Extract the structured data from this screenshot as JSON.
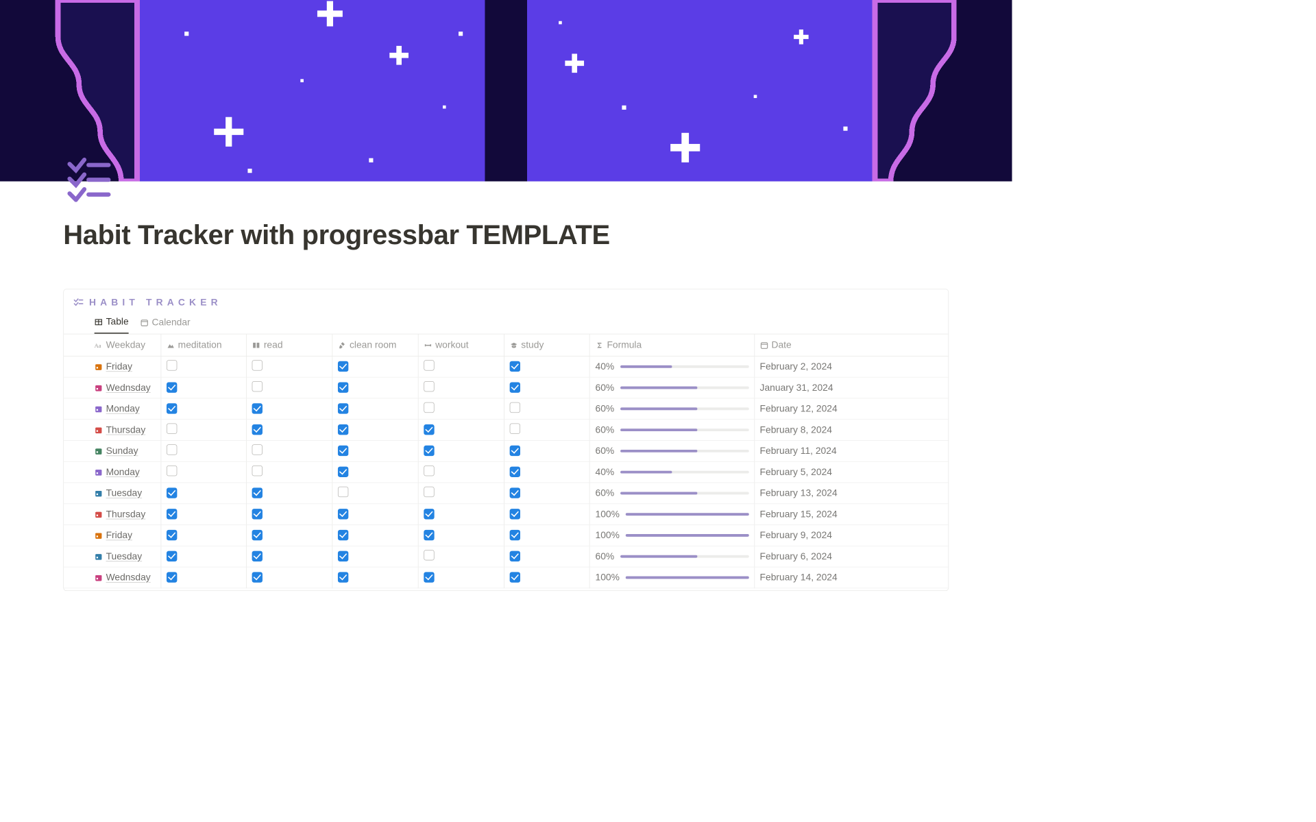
{
  "page": {
    "title": "Habit Tracker with progressbar TEMPLATE"
  },
  "block": {
    "title": "HABIT TRACKER"
  },
  "tabs": [
    {
      "label": "Table",
      "active": true,
      "icon": "table"
    },
    {
      "label": "Calendar",
      "active": false,
      "icon": "calendar"
    }
  ],
  "columns": {
    "weekday": {
      "label": "Weekday",
      "icon": "title"
    },
    "meditation": {
      "label": "meditation",
      "icon": "mountain"
    },
    "read": {
      "label": "read",
      "icon": "book"
    },
    "clean": {
      "label": "clean room",
      "icon": "broom"
    },
    "workout": {
      "label": "workout",
      "icon": "dumbbell"
    },
    "study": {
      "label": "study",
      "icon": "grad"
    },
    "formula": {
      "label": "Formula",
      "icon": "sigma"
    },
    "date": {
      "label": "Date",
      "icon": "calendar"
    }
  },
  "weekday_colors": {
    "Friday": "#d9730d",
    "Wednsday": "#c9407f",
    "Monday": "#8a67cb",
    "Thursday": "#d44c47",
    "Sunday": "#448361",
    "Tuesday": "#337ea9"
  },
  "rows": [
    {
      "weekday": "Friday",
      "checks": [
        false,
        false,
        true,
        false,
        true
      ],
      "pct": "40%",
      "pval": 40,
      "date": "February 2, 2024"
    },
    {
      "weekday": "Wednsday",
      "checks": [
        true,
        false,
        true,
        false,
        true
      ],
      "pct": "60%",
      "pval": 60,
      "date": "January 31, 2024"
    },
    {
      "weekday": "Monday",
      "checks": [
        true,
        true,
        true,
        false,
        false
      ],
      "pct": "60%",
      "pval": 60,
      "date": "February 12, 2024"
    },
    {
      "weekday": "Thursday",
      "checks": [
        false,
        true,
        true,
        true,
        false
      ],
      "pct": "60%",
      "pval": 60,
      "date": "February 8, 2024"
    },
    {
      "weekday": "Sunday",
      "checks": [
        false,
        false,
        true,
        true,
        true
      ],
      "pct": "60%",
      "pval": 60,
      "date": "February 11, 2024"
    },
    {
      "weekday": "Monday",
      "checks": [
        false,
        false,
        true,
        false,
        true
      ],
      "pct": "40%",
      "pval": 40,
      "date": "February 5, 2024"
    },
    {
      "weekday": "Tuesday",
      "checks": [
        true,
        true,
        false,
        false,
        true
      ],
      "pct": "60%",
      "pval": 60,
      "date": "February 13, 2024"
    },
    {
      "weekday": "Thursday",
      "checks": [
        true,
        true,
        true,
        true,
        true
      ],
      "pct": "100%",
      "pval": 100,
      "date": "February 15, 2024"
    },
    {
      "weekday": "Friday",
      "checks": [
        true,
        true,
        true,
        true,
        true
      ],
      "pct": "100%",
      "pval": 100,
      "date": "February 9, 2024"
    },
    {
      "weekday": "Tuesday",
      "checks": [
        true,
        true,
        true,
        false,
        true
      ],
      "pct": "60%",
      "pval": 60,
      "date": "February 6, 2024"
    },
    {
      "weekday": "Wednsday",
      "checks": [
        true,
        true,
        true,
        true,
        true
      ],
      "pct": "100%",
      "pval": 100,
      "date": "February 14, 2024"
    }
  ]
}
